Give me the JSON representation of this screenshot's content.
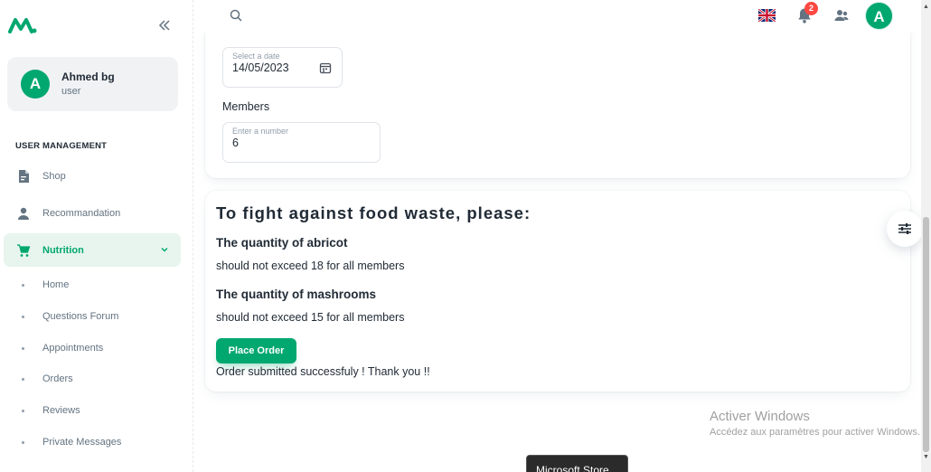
{
  "sidebar": {
    "account": {
      "initial": "A",
      "name": "Ahmed bg",
      "role": "user"
    },
    "section_title": "USER MANAGEMENT",
    "items": [
      {
        "label": "Shop",
        "icon": "file-icon"
      },
      {
        "label": "Recommandation",
        "icon": "user-icon"
      },
      {
        "label": "Nutrition",
        "icon": "cart-icon",
        "active": true
      }
    ],
    "sub_items": [
      {
        "label": "Home"
      },
      {
        "label": "Questions Forum"
      },
      {
        "label": "Appointments"
      },
      {
        "label": "Orders"
      },
      {
        "label": "Reviews"
      },
      {
        "label": "Private Messages"
      }
    ]
  },
  "topbar": {
    "notifications_count": "2",
    "avatar_initial": "A"
  },
  "form": {
    "date_label": "Select a date",
    "date_value": "14/05/2023",
    "members_title": "Members",
    "members_label": "Enter a number",
    "members_value": "6"
  },
  "waste": {
    "title": "To fight against food waste, please:",
    "items": [
      {
        "title": "The quantity of abricot",
        "text": "should not exceed 18 for all members"
      },
      {
        "title": "The quantity of mashrooms",
        "text": "should not exceed 15 for all members"
      }
    ],
    "button_label": "Place Order",
    "success_message": "Order submitted successfuly ! Thank you !!"
  },
  "watermark": {
    "title": "Activer Windows",
    "subtitle": "Accédez aux paramètres pour activer Windows."
  },
  "tooltip": "Microsoft Store",
  "colors": {
    "accent": "#00a76f",
    "badge": "#ff4842",
    "text": "#212b36",
    "muted": "#637381"
  }
}
